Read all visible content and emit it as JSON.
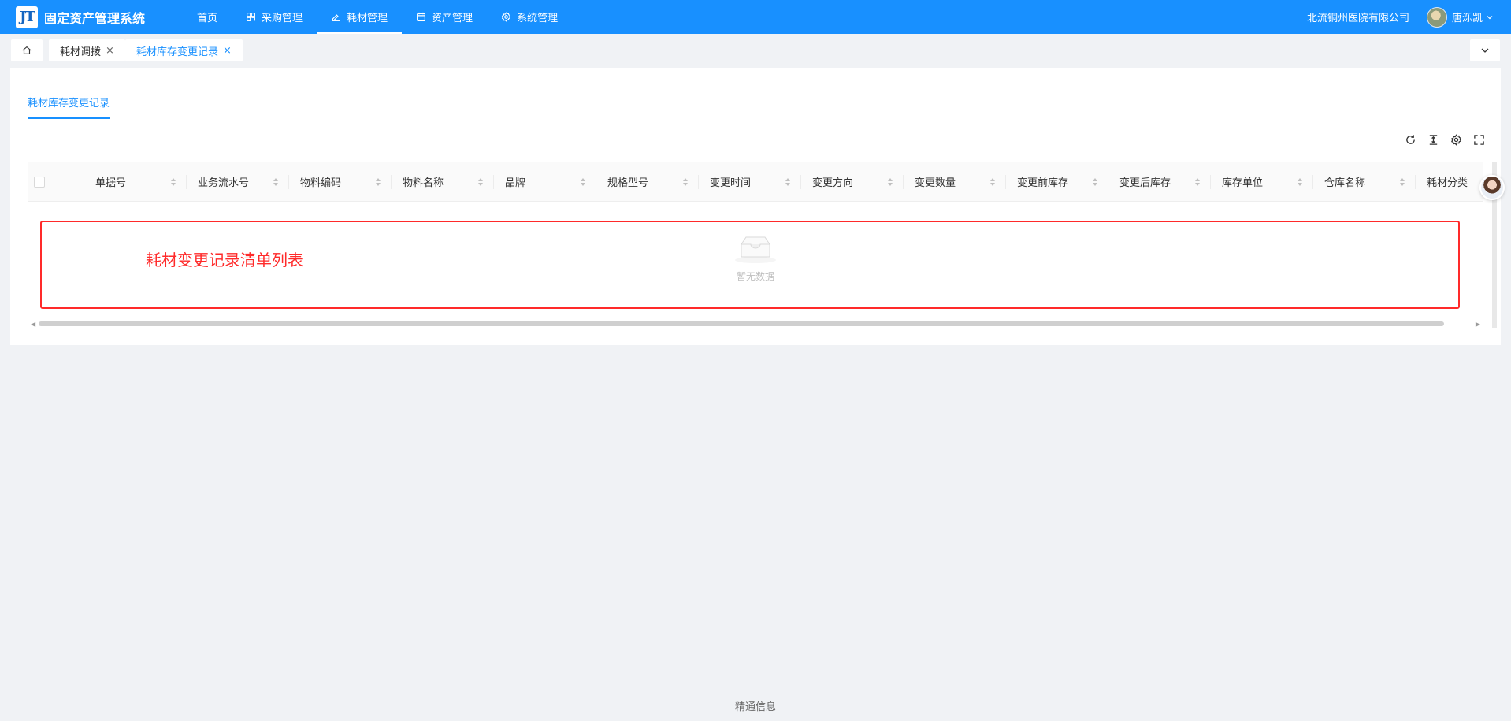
{
  "app": {
    "logo_text": "JT",
    "title": "固定资产管理系统"
  },
  "nav": [
    {
      "label": "首页",
      "icon": "none"
    },
    {
      "label": "采购管理",
      "icon": "grid-icon"
    },
    {
      "label": "耗材管理",
      "icon": "edit-icon",
      "active": true
    },
    {
      "label": "资产管理",
      "icon": "calendar-icon"
    },
    {
      "label": "系统管理",
      "icon": "gear-icon"
    }
  ],
  "header": {
    "org": "北流铜州医院有限公司",
    "user": "唐泺凯"
  },
  "tabs": [
    {
      "label": "耗材调拨"
    },
    {
      "label": "耗材库存变更记录",
      "active": true
    }
  ],
  "subtab": {
    "label": "耗材库存变更记录"
  },
  "table": {
    "columns": [
      "单据号",
      "业务流水号",
      "物料编码",
      "物料名称",
      "品牌",
      "规格型号",
      "变更时间",
      "变更方向",
      "变更数量",
      "变更前库存",
      "变更后库存",
      "库存单位",
      "仓库名称",
      "耗材分类"
    ],
    "empty_text": "暂无数据"
  },
  "annotation": {
    "label": "耗材变更记录清单列表",
    "color": "#ff2a2a"
  },
  "footer": {
    "text": "精通信息"
  },
  "colors": {
    "primary": "#1890ff",
    "background": "#f0f2f5"
  }
}
